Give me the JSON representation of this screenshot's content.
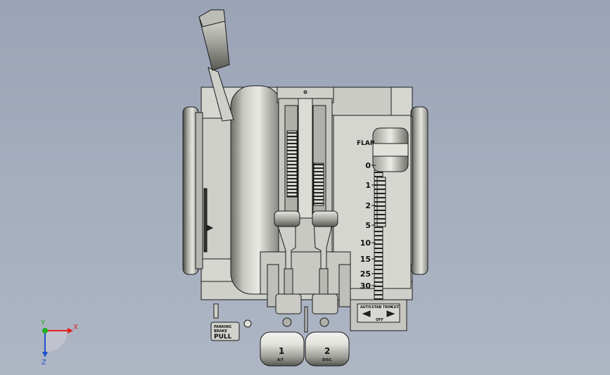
{
  "scene": {
    "background_top": "#9aa4b6",
    "background_bottom": "#aeb6c4",
    "part_color": "#d4d4cf",
    "edge_color": "#1a1a1a"
  },
  "flap_scale": {
    "header": "FLAP",
    "values": [
      "0",
      "1",
      "2",
      "5",
      "10",
      "15",
      "25",
      "30"
    ]
  },
  "parking_brake": {
    "line1": "PARKING",
    "line2": "BRAKE",
    "line3": "PULL"
  },
  "throttle_1": {
    "label": "1",
    "sub": "A/T"
  },
  "throttle_2": {
    "label": "2",
    "sub": "DISC"
  },
  "stab_trim_panel": {
    "left": "AUTO",
    "mid": "STAB TRIM",
    "right": "CUT",
    "bottom": "OFF"
  },
  "triad": {
    "x_label": "X",
    "y_label": "Y",
    "z_label": "Z",
    "x_color": "#e02020",
    "y_color": "#20b020",
    "z_color": "#2050d0"
  }
}
